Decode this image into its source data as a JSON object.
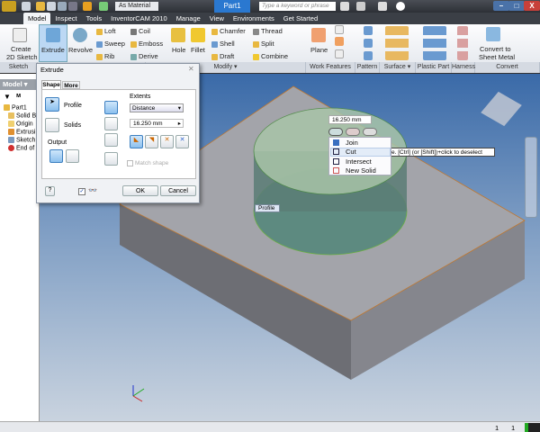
{
  "titlebar": {
    "material": "As Material",
    "document_title": "Part1",
    "search_placeholder": "Type a keyword or phrase",
    "minimize": "–",
    "restore": "□",
    "close": "X"
  },
  "tabs": [
    "Model",
    "Inspect",
    "Tools",
    "InventorCAM 2010",
    "Manage",
    "View",
    "Environments",
    "Get Started"
  ],
  "active_tab": "Model",
  "ribbon": {
    "sketch": {
      "create": "Create",
      "create2": "2D Sketch"
    },
    "create": {
      "extrude": "Extrude",
      "revolve": "Revolve",
      "loft": "Loft",
      "sweep": "Sweep",
      "rib": "Rib",
      "coil": "Coil",
      "emboss": "Emboss",
      "derive": "Derive"
    },
    "modify": {
      "hole": "Hole",
      "fillet": "Fillet",
      "chamfer": "Chamfer",
      "shell": "Shell",
      "draft": "Draft",
      "thread": "Thread",
      "split": "Split",
      "combine": "Combine"
    },
    "work": {
      "plane": "Plane"
    },
    "convert": {
      "l1": "Convert to",
      "l2": "Sheet Metal"
    },
    "panels": [
      "Sketch",
      "Modify ▾",
      "Work Features",
      "Pattern",
      "Surface ▾",
      "Plastic Part",
      "Harness",
      "Convert"
    ]
  },
  "browser": {
    "header": "Model ▾",
    "items": [
      "Part1",
      "Solid B",
      "Origin",
      "Extrusi",
      "Sketch",
      "End of"
    ]
  },
  "dialog": {
    "title": "Extrude",
    "tabs": [
      "Shape",
      "More"
    ],
    "profile": "Profile",
    "solids": "Solids",
    "output": "Output",
    "extents": "Extents",
    "extents_type": "Distance",
    "distance": "16.250 mm",
    "match_shape": "Match shape",
    "ok": "OK",
    "cancel": "Cancel",
    "preview_checked": true
  },
  "viewport": {
    "distance_input": "16.250 mm",
    "menu": [
      "Join",
      "Cut",
      "Intersect",
      "New Solid"
    ],
    "highlighted": "Cut",
    "tooltip": "e. [Ctrl] (or [Shift])+click to deselect",
    "profile_label": "Profile"
  },
  "status": {
    "v1": "1",
    "v2": "1"
  },
  "colors": {
    "accent": "#2a78d0",
    "viewport_top": "#3a6aa8",
    "solid": "#8e8f95",
    "preview": "#7fb8a0"
  }
}
